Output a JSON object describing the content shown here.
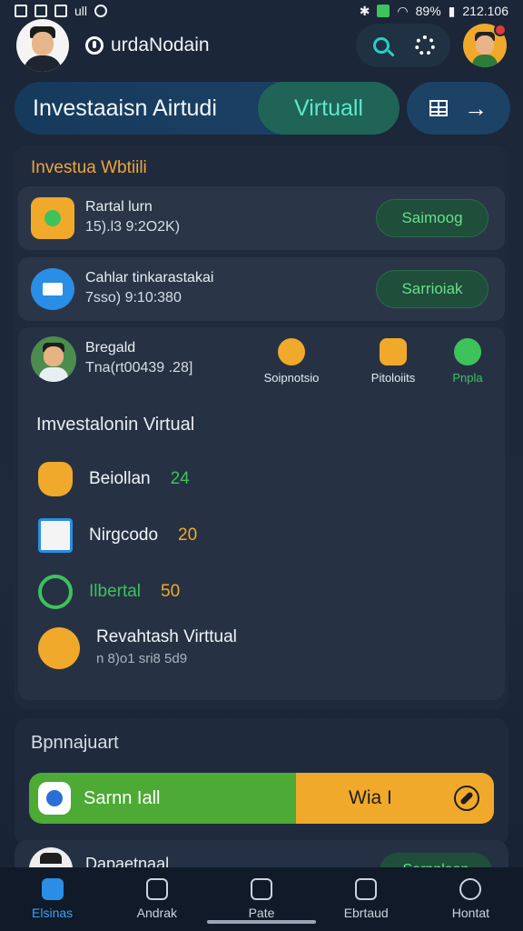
{
  "status_bar": {
    "left_icons": [
      "M",
      "S",
      "E",
      "ull",
      "O"
    ],
    "right_text": "89%",
    "time": "212.106"
  },
  "header": {
    "app_name": "urdaNodain",
    "icons": [
      "search-icon",
      "gear-icon"
    ]
  },
  "hero": {
    "title": "Investaaisn Airtudi",
    "active_tab": "Virtuall"
  },
  "section": {
    "title": "Investua Wbtiili",
    "rows": [
      {
        "title": "Rartal lurn",
        "sub": "15).l3 9:2O2K)",
        "button": "Saimoog"
      },
      {
        "title": "Cahlar tinkarastakai",
        "sub": "7sso) 9:10:380",
        "button": "Sarrioiak"
      }
    ],
    "profile": {
      "name": "Bregald",
      "sub": "Tna(rt00439 .28]",
      "actions": [
        {
          "label": "Soipnotsio"
        },
        {
          "label": "Pitoloiits"
        },
        {
          "label": "Pnpla"
        }
      ]
    },
    "sub_heading": "Imvestalonin Virtual",
    "items": [
      {
        "label": "Beiollan",
        "num": "24"
      },
      {
        "label": "Nirgcodo",
        "num": "20"
      },
      {
        "label": "Ilbertal",
        "num": "50"
      },
      {
        "label": "Revahtash Virttual",
        "sub": "n 8)o1 sri8 5d9"
      }
    ]
  },
  "bottom_card": {
    "title": "Bpnnajuart",
    "left_label": "Sarnn Iall",
    "right_label": "Wia I"
  },
  "peek": {
    "title": "Dapaetnaal",
    "button": "Sarnnlaan"
  },
  "nav": [
    {
      "label": "Elsinas",
      "active": true
    },
    {
      "label": "Andrak",
      "active": false
    },
    {
      "label": "Pate",
      "active": false
    },
    {
      "label": "Ebrtaud",
      "active": false
    },
    {
      "label": "Hontat",
      "active": false
    }
  ]
}
